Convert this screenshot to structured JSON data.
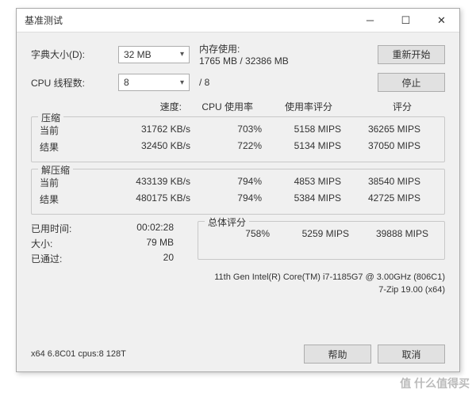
{
  "title": "基准测试",
  "dict_size_label": "字典大小(D):",
  "dict_size_value": "32 MB",
  "mem_label": "内存使用:",
  "mem_value": "1765 MB / 32386 MB",
  "threads_label": "CPU 线程数:",
  "threads_value": "8",
  "threads_total": "/ 8",
  "restart_btn": "重新开始",
  "stop_btn": "停止",
  "headers": {
    "speed": "速度:",
    "cpu": "CPU 使用率",
    "rating": "使用率评分",
    "score": "评分"
  },
  "compress": {
    "title": "压缩",
    "current_label": "当前",
    "result_label": "结果",
    "current": {
      "speed": "31762 KB/s",
      "cpu": "703%",
      "rating": "5158 MIPS",
      "score": "36265 MIPS"
    },
    "result": {
      "speed": "32450 KB/s",
      "cpu": "722%",
      "rating": "5134 MIPS",
      "score": "37050 MIPS"
    }
  },
  "decompress": {
    "title": "解压缩",
    "current_label": "当前",
    "result_label": "结果",
    "current": {
      "speed": "433139 KB/s",
      "cpu": "794%",
      "rating": "4853 MIPS",
      "score": "38540 MIPS"
    },
    "result": {
      "speed": "480175 KB/s",
      "cpu": "794%",
      "rating": "5384 MIPS",
      "score": "42725 MIPS"
    }
  },
  "stats": {
    "elapsed_label": "已用时间:",
    "elapsed": "00:02:28",
    "size_label": "大小:",
    "size": "79 MB",
    "passes_label": "已通过:",
    "passes": "20"
  },
  "total": {
    "title": "总体评分",
    "cpu": "758%",
    "rating": "5259 MIPS",
    "score": "39888 MIPS"
  },
  "cpu_info": "11th Gen Intel(R) Core(TM) i7-1185G7 @ 3.00GHz (806C1)",
  "zip_info": "7-Zip 19.00 (x64)",
  "version": "x64 6.8C01 cpus:8 128T",
  "help_btn": "帮助",
  "cancel_btn": "取消",
  "watermark": "值 什么值得买"
}
